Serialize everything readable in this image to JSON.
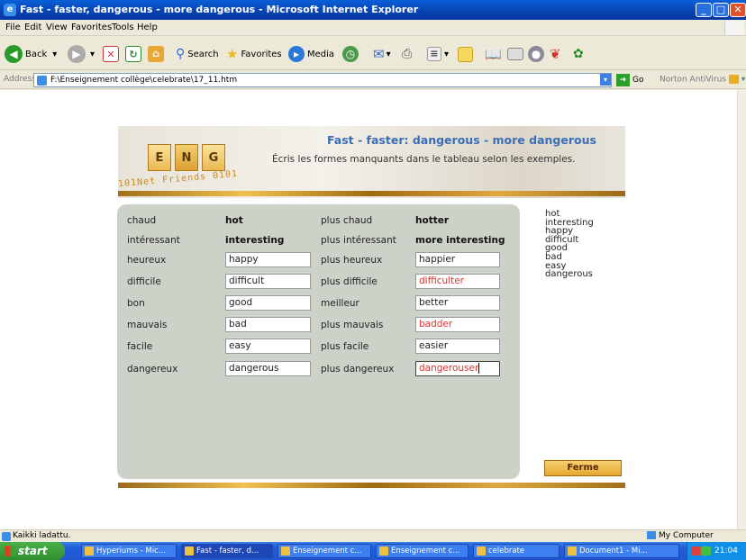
{
  "window": {
    "title": "Fast - faster, dangerous - more dangerous - Microsoft Internet Explorer"
  },
  "menu": [
    "File",
    "Edit",
    "View",
    "Favorites",
    "Tools",
    "Help"
  ],
  "toolbar": {
    "back": "Back",
    "search": "Search",
    "favorites": "Favorites",
    "media": "Media"
  },
  "address": {
    "label": "Address",
    "url": "F:\\Enseignement collège\\celebrate\\17_11.htm",
    "go": "Go",
    "norton": "Norton AntiVirus"
  },
  "banner": {
    "tiles": [
      "E",
      "N",
      "G"
    ],
    "brand": "101Net Friends 0101",
    "heading": "Fast - faster: dangerous - more dangerous",
    "instruction": "Écris les formes manquants dans le tableau selon les exemples."
  },
  "exercise": {
    "rows": [
      {
        "fr": "chaud",
        "en": "hot",
        "fr_comp": "plus chaud",
        "en_comp": "hotter",
        "static": true
      },
      {
        "fr": "intéressant",
        "en": "interesting",
        "fr_comp": "plus intéressant",
        "en_comp": "more interesting",
        "static": true
      },
      {
        "fr": "heureux",
        "en": "happy",
        "fr_comp": "plus heureux",
        "en_comp": "happier",
        "correct": true
      },
      {
        "fr": "difficile",
        "en": "difficult",
        "fr_comp": "plus difficile",
        "en_comp": "difficulter",
        "correct": false
      },
      {
        "fr": "bon",
        "en": "good",
        "fr_comp": "meilleur",
        "en_comp": "better",
        "correct": true
      },
      {
        "fr": "mauvais",
        "en": "bad",
        "fr_comp": "plus mauvais",
        "en_comp": "badder",
        "correct": false
      },
      {
        "fr": "facile",
        "en": "easy",
        "fr_comp": "plus facile",
        "en_comp": "easier",
        "correct": true
      },
      {
        "fr": "dangereux",
        "en": "dangerous",
        "fr_comp": "plus dangereux",
        "en_comp": "dangerouser",
        "correct": false,
        "focused": true
      }
    ]
  },
  "word_list": [
    "hot",
    "interesting",
    "happy",
    "difficult",
    "good",
    "bad",
    "easy",
    "dangerous"
  ],
  "ferme_label": "Ferme",
  "status": {
    "left": "Kaikki ladattu.",
    "zone": "My Computer"
  },
  "taskbar": {
    "start": "start",
    "tasks": [
      "Hyperiums - Mic...",
      "Fast - faster, d...",
      "Enseignement c...",
      "Enseignement c...",
      "celebrate",
      "Document1 - Mi..."
    ],
    "active_task": 1,
    "clock": "21:04"
  }
}
